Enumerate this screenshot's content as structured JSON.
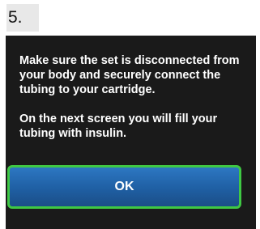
{
  "step": {
    "number_label": "5."
  },
  "dialog": {
    "paragraph_1": "Make sure the set is disconnected from your body and securely connect the tubing to your cartridge.",
    "paragraph_2": "On the next screen you will fill your tubing with insulin.",
    "ok_label": "OK"
  },
  "colors": {
    "screen_background": "#1a1a1a",
    "button_fill": "#1f5fa3",
    "button_border": "#3fc843",
    "text": "#ffffff"
  }
}
